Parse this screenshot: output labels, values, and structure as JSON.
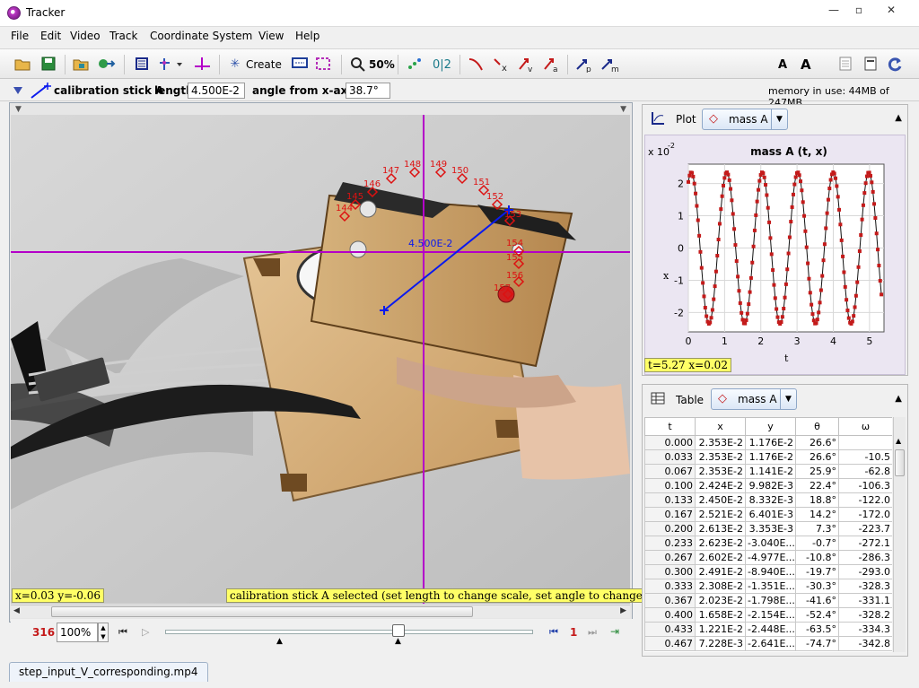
{
  "window": {
    "title": "Tracker",
    "controls": [
      "—",
      "▫",
      "✕"
    ]
  },
  "menu": [
    "File",
    "Edit",
    "Video",
    "Track",
    "Coordinate System",
    "View",
    "Help"
  ],
  "toolbar": {
    "create_label": "Create",
    "zoom_label": "50%",
    "points_label": "0|2",
    "font_small": "A",
    "font_large": "A"
  },
  "calibration": {
    "name": "calibration stick A",
    "length_label": "length",
    "length_value": "4.500E-2",
    "angle_label": "angle from x-axis",
    "angle_value": "38.7°",
    "memory": "memory in use: 44MB of 247MB"
  },
  "video": {
    "stick_length_label": "4.500E-2",
    "readout_xy": "x=0.03  y=-0.06",
    "status_message": "calibration stick A selected (set length to change scale, set angle to change tilt)",
    "frame_labels": [
      "144",
      "145",
      "146",
      "147",
      "148",
      "149",
      "150",
      "151",
      "152",
      "153",
      "154",
      "155",
      "156",
      "157"
    ],
    "colors": {
      "axes": "#b400c8",
      "track": "#dd1111",
      "calibration": "#0a1aee"
    }
  },
  "player": {
    "frame_number": "316",
    "zoom": "100%",
    "step_size": "1"
  },
  "plot_panel": {
    "title": "Plot",
    "track": "mass A",
    "chart_title": "mass A (t, x)",
    "scale_label": "x 10",
    "scale_exp": "-2",
    "readout": "t=5.27  x=0.02"
  },
  "chart_data": {
    "type": "scatter",
    "title": "mass A (t, x)",
    "xlabel": "t",
    "ylabel": "x",
    "scale_note": "x 10^-2",
    "xlim": [
      0,
      5.4
    ],
    "ylim": [
      -2.6,
      2.6
    ],
    "x_ticks": [
      "0",
      "1",
      "2",
      "3",
      "4",
      "5"
    ],
    "y_ticks": [
      "2",
      "1",
      "0",
      "-1",
      "-2"
    ],
    "x_tick_values": [
      0,
      1,
      2,
      3,
      4,
      5
    ],
    "y_tick_values": [
      2,
      1,
      0,
      -1,
      -2
    ],
    "series": [
      {
        "amplitude": 2.35,
        "period": 0.98,
        "phase_t": 0.08,
        "t_start": 0.0,
        "t_end": 5.33,
        "dt": 0.0333,
        "color": "#c41a1a"
      }
    ],
    "grid": true
  },
  "table_panel": {
    "title": "Table",
    "track": "mass A",
    "columns": [
      "t",
      "x",
      "y",
      "θ",
      "ω"
    ],
    "rows": [
      [
        "0.000",
        "2.353E-2",
        "1.176E-2",
        "26.6°",
        ""
      ],
      [
        "0.033",
        "2.353E-2",
        "1.176E-2",
        "26.6°",
        "-10.5"
      ],
      [
        "0.067",
        "2.353E-2",
        "1.141E-2",
        "25.9°",
        "-62.8"
      ],
      [
        "0.100",
        "2.424E-2",
        "9.982E-3",
        "22.4°",
        "-106.3"
      ],
      [
        "0.133",
        "2.450E-2",
        "8.332E-3",
        "18.8°",
        "-122.0"
      ],
      [
        "0.167",
        "2.521E-2",
        "6.401E-3",
        "14.2°",
        "-172.0"
      ],
      [
        "0.200",
        "2.613E-2",
        "3.353E-3",
        "7.3°",
        "-223.7"
      ],
      [
        "0.233",
        "2.623E-2",
        "-3.040E...",
        "-0.7°",
        "-272.1"
      ],
      [
        "0.267",
        "2.602E-2",
        "-4.977E...",
        "-10.8°",
        "-286.3"
      ],
      [
        "0.300",
        "2.491E-2",
        "-8.940E...",
        "-19.7°",
        "-293.0"
      ],
      [
        "0.333",
        "2.308E-2",
        "-1.351E...",
        "-30.3°",
        "-328.3"
      ],
      [
        "0.367",
        "2.023E-2",
        "-1.798E...",
        "-41.6°",
        "-331.1"
      ],
      [
        "0.400",
        "1.658E-2",
        "-2.154E...",
        "-52.4°",
        "-328.2"
      ],
      [
        "0.433",
        "1.221E-2",
        "-2.448E...",
        "-63.5°",
        "-334.3"
      ],
      [
        "0.467",
        "7.228E-3",
        "-2.641E...",
        "-74.7°",
        "-342.8"
      ]
    ]
  },
  "file_tab": "step_input_V_corresponding.mp4"
}
